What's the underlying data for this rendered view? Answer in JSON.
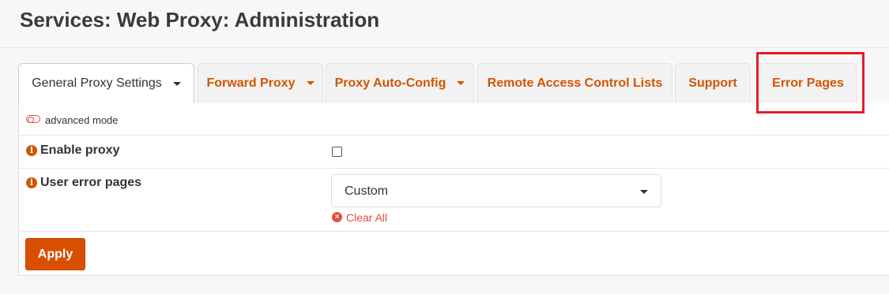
{
  "page": {
    "title": "Services: Web Proxy: Administration"
  },
  "tabs": [
    {
      "label": "General Proxy Settings",
      "active": true,
      "dropdown": true
    },
    {
      "label": "Forward Proxy",
      "active": false,
      "dropdown": true
    },
    {
      "label": "Proxy Auto-Config",
      "active": false,
      "dropdown": true
    },
    {
      "label": "Remote Access Control Lists",
      "active": false,
      "dropdown": false
    },
    {
      "label": "Support",
      "active": false,
      "dropdown": false
    },
    {
      "label": "Error Pages",
      "active": false,
      "dropdown": false,
      "highlighted": true
    }
  ],
  "advanced_mode": {
    "label": "advanced mode",
    "enabled": false
  },
  "form": {
    "enable_proxy": {
      "label": "Enable proxy",
      "checked": false
    },
    "user_error_pages": {
      "label": "User error pages",
      "selected": "Custom",
      "clear_label": "Clear All"
    }
  },
  "apply_label": "Apply",
  "colors": {
    "accent": "#d35400",
    "highlight": "#e01e2b",
    "danger": "#e74c3c"
  }
}
